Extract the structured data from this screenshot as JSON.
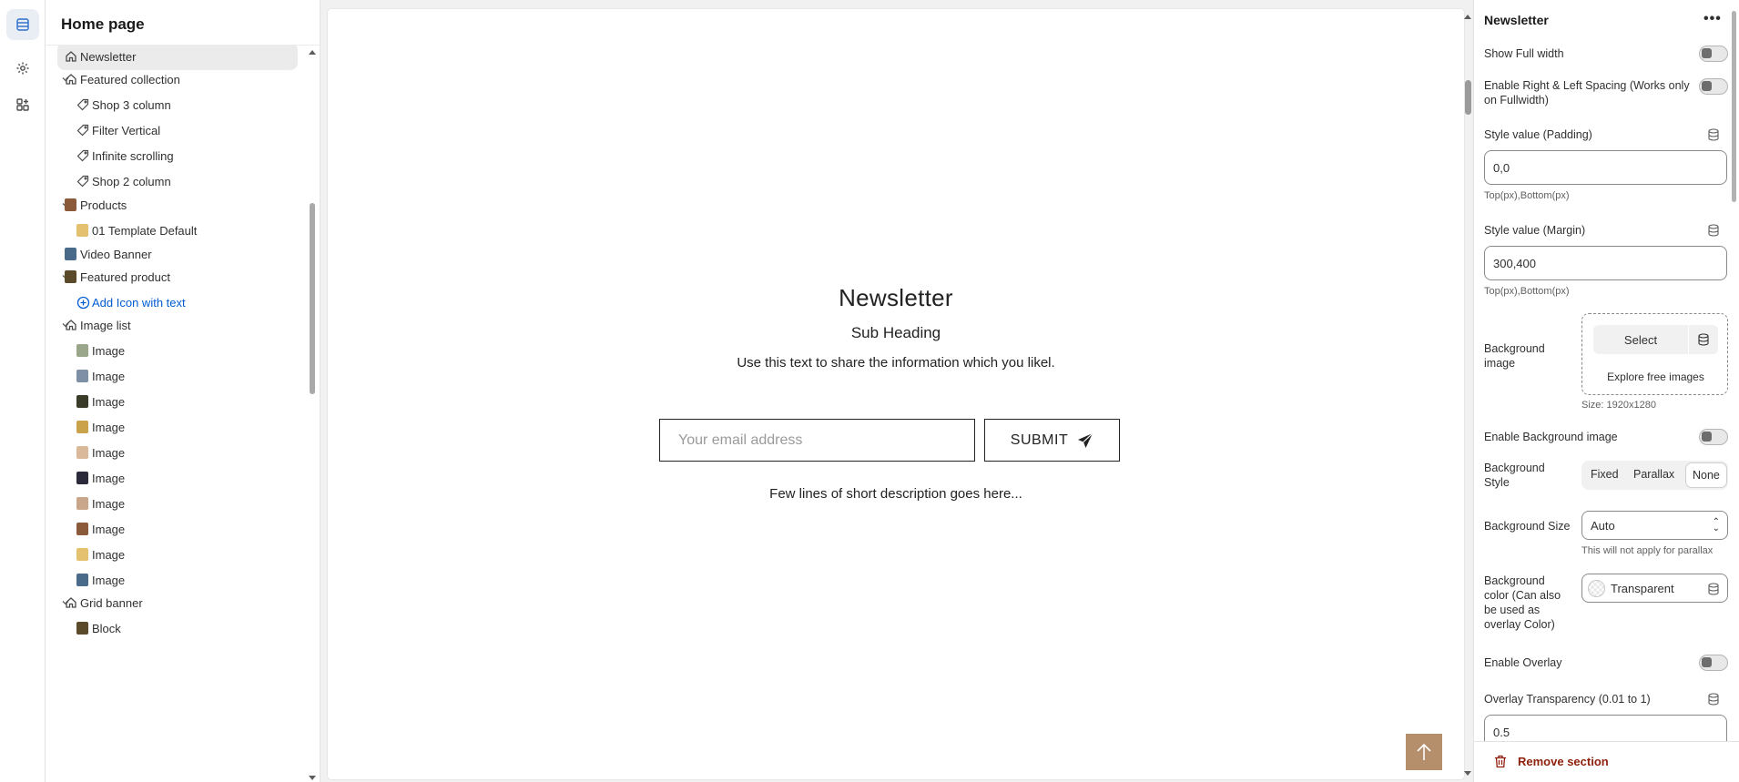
{
  "sidebar": {
    "title": "Home page",
    "items": [
      {
        "label": "Newsletter",
        "kind": "section",
        "icon": "home-icon",
        "selected": true
      },
      {
        "label": "Featured collection",
        "kind": "section",
        "icon": "home-icon"
      },
      {
        "label": "Shop 3 column",
        "kind": "child",
        "icon": "tag-icon"
      },
      {
        "label": "Filter Vertical",
        "kind": "child",
        "icon": "tag-icon"
      },
      {
        "label": "Infinite scrolling",
        "kind": "child",
        "icon": "tag-icon"
      },
      {
        "label": "Shop 2 column",
        "kind": "child",
        "icon": "tag-icon"
      },
      {
        "label": "Products",
        "kind": "section",
        "icon": "product-thumbnail"
      },
      {
        "label": "01 Template Default",
        "kind": "child",
        "icon": "product-thumbnail"
      },
      {
        "label": "Video Banner",
        "kind": "section",
        "icon": "video-thumbnail"
      },
      {
        "label": "Featured product",
        "kind": "section",
        "icon": "product-thumbnail"
      },
      {
        "label": "Add Icon with text",
        "kind": "add",
        "icon": "plus-circle-icon"
      },
      {
        "label": "Image list",
        "kind": "section",
        "icon": "home-icon"
      },
      {
        "label": "Image",
        "kind": "child",
        "icon": "image-thumbnail"
      },
      {
        "label": "Image",
        "kind": "child",
        "icon": "image-thumbnail"
      },
      {
        "label": "Image",
        "kind": "child",
        "icon": "image-thumbnail"
      },
      {
        "label": "Image",
        "kind": "child",
        "icon": "image-thumbnail"
      },
      {
        "label": "Image",
        "kind": "child",
        "icon": "image-thumbnail"
      },
      {
        "label": "Image",
        "kind": "child",
        "icon": "image-thumbnail"
      },
      {
        "label": "Image",
        "kind": "child",
        "icon": "image-thumbnail"
      },
      {
        "label": "Image",
        "kind": "child",
        "icon": "image-thumbnail"
      },
      {
        "label": "Image",
        "kind": "child",
        "icon": "image-thumbnail"
      },
      {
        "label": "Image",
        "kind": "child",
        "icon": "image-thumbnail"
      },
      {
        "label": "Grid banner",
        "kind": "section",
        "icon": "home-icon"
      },
      {
        "label": "Block",
        "kind": "child",
        "icon": "image-thumbnail"
      }
    ]
  },
  "preview": {
    "title": "Newsletter",
    "subheading": "Sub Heading",
    "text": "Use this text to share the information which you likel.",
    "email_placeholder": "Your email address",
    "submit_label": "SUBMIT",
    "description": "Few lines of short description goes here...",
    "back_to_top_color": "#b58e6b"
  },
  "panel": {
    "title": "Newsletter",
    "show_full_width": "Show Full width",
    "enable_spacing": "Enable Right & Left Spacing (Works only on Fullwidth)",
    "padding_label": "Style value (Padding)",
    "padding_value": "0,0",
    "padding_hint": "Top(px),Bottom(px)",
    "margin_label": "Style value (Margin)",
    "margin_value": "300,400",
    "margin_hint": "Top(px),Bottom(px)",
    "bg_image_label": "Background image",
    "select_label": "Select",
    "explore_label": "Explore free images",
    "size_hint": "Size: 1920x1280",
    "enable_bg_image": "Enable Background image",
    "bg_style_label": "Background Style",
    "bg_style_options": [
      "Fixed",
      "Parallax",
      "None"
    ],
    "bg_style_selected": "None",
    "bg_size_label": "Background Size",
    "bg_size_value": "Auto",
    "bg_size_hint": "This will not apply for parallax",
    "bg_color_label": "Background color (Can also be used as overlay Color)",
    "bg_color_value": "Transparent",
    "enable_overlay": "Enable Overlay",
    "overlay_label": "Overlay Transparency (0.01 to 1)",
    "overlay_value": "0.5",
    "remove_label": "Remove section",
    "remove_color": "#8e1f0b"
  }
}
